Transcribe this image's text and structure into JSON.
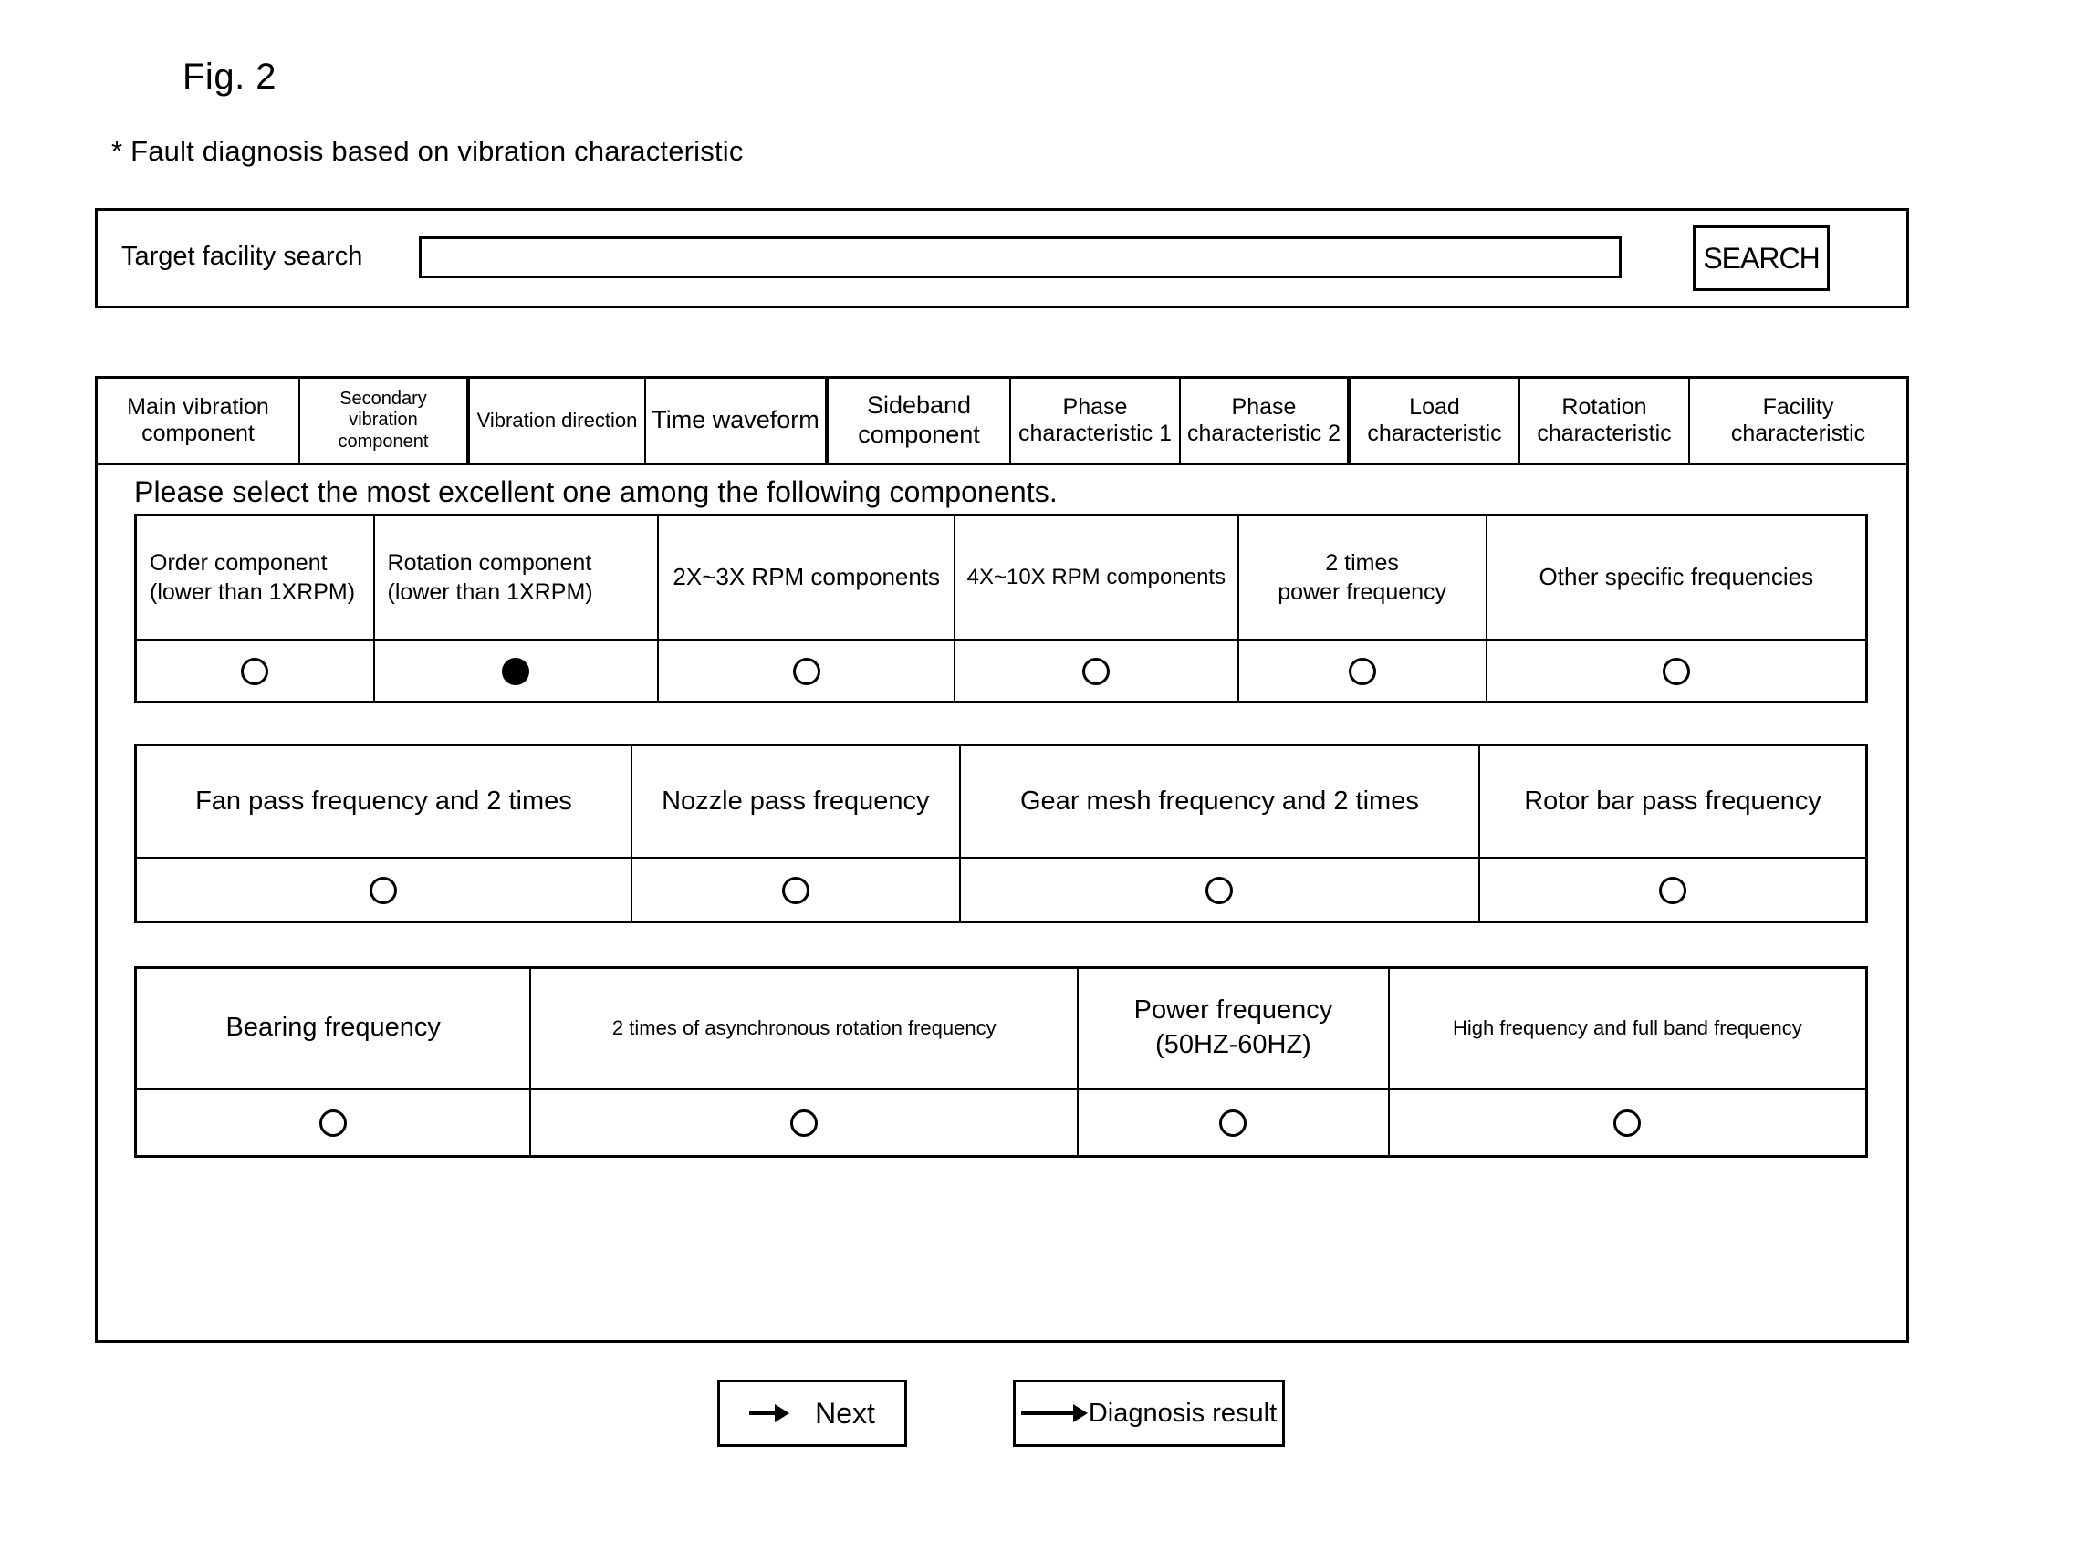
{
  "figure": {
    "number": "Fig. 2",
    "subtitle": "* Fault diagnosis based on vibration characteristic"
  },
  "search": {
    "label": "Target facility search",
    "value": "",
    "placeholder": "",
    "button_label": "SEARCH"
  },
  "tabs": [
    {
      "label": "Main vibration\ncomponent"
    },
    {
      "label": "Secondary vibration\ncomponent"
    },
    {
      "label": "Vibration direction"
    },
    {
      "label": "Time waveform"
    },
    {
      "label": "Sideband\ncomponent"
    },
    {
      "label": "Phase\ncharacteristic 1"
    },
    {
      "label": "Phase\ncharacteristic 2"
    },
    {
      "label": "Load\ncharacteristic"
    },
    {
      "label": "Rotation\ncharacteristic"
    },
    {
      "label": "Facility\ncharacteristic"
    }
  ],
  "instruction": "Please select the most excellent one among the following components.",
  "option_groups": [
    {
      "options": [
        {
          "label": "Order component\n(lower than 1XRPM)",
          "selected": false
        },
        {
          "label": "Rotation component\n(lower than 1XRPM)",
          "selected": true
        },
        {
          "label": "2X~3X RPM components",
          "selected": false
        },
        {
          "label": "4X~10X RPM components",
          "selected": false
        },
        {
          "label": "2 times\npower frequency",
          "selected": false
        },
        {
          "label": "Other specific frequencies",
          "selected": false
        }
      ]
    },
    {
      "options": [
        {
          "label": "Fan pass frequency and 2 times",
          "selected": false
        },
        {
          "label": "Nozzle pass frequency",
          "selected": false
        },
        {
          "label": "Gear mesh frequency and 2 times",
          "selected": false
        },
        {
          "label": "Rotor bar pass frequency",
          "selected": false
        }
      ]
    },
    {
      "options": [
        {
          "label": "Bearing frequency",
          "selected": false
        },
        {
          "label": "2 times of asynchronous rotation frequency",
          "selected": false
        },
        {
          "label": "Power frequency\n(50HZ-60HZ)",
          "selected": false
        },
        {
          "label": "High frequency and full band frequency",
          "selected": false
        }
      ]
    }
  ],
  "footer_buttons": [
    {
      "label": "Next",
      "icon": "arrow-right-icon"
    },
    {
      "label": "Diagnosis result",
      "icon": "arrow-right-icon"
    }
  ],
  "colors": {
    "line": "#000000",
    "background": "#ffffff"
  }
}
